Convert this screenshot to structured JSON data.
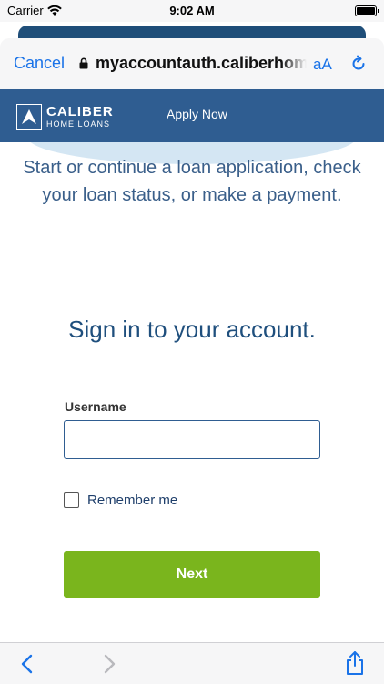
{
  "status_bar": {
    "carrier": "Carrier",
    "time": "9:02 AM",
    "icons": [
      "wifi-icon",
      "battery-icon"
    ]
  },
  "browser": {
    "cancel_label": "Cancel",
    "url": "myaccountauth.caliberhomeloans.com",
    "text_size_label": "aA",
    "icons": [
      "lock-icon",
      "reload-icon"
    ]
  },
  "site_header": {
    "logo_line1": "CALIBER",
    "logo_line2": "HOME LOANS",
    "apply_now_label": "Apply Now"
  },
  "intro_text": "Start or continue a loan application, check your loan status, or make a payment.",
  "signin": {
    "title": "Sign in to your account.",
    "username_label": "Username",
    "username_value": "",
    "remember_label": "Remember me",
    "remember_checked": false,
    "next_label": "Next"
  },
  "toolbar": {
    "icons": [
      "back-arrow-icon",
      "forward-arrow-icon",
      "share-icon"
    ]
  },
  "colors": {
    "header_blue": "#2f5d91",
    "link_blue": "#1a73e8",
    "next_green": "#7ab51d",
    "heading_blue": "#1f4f7d"
  }
}
